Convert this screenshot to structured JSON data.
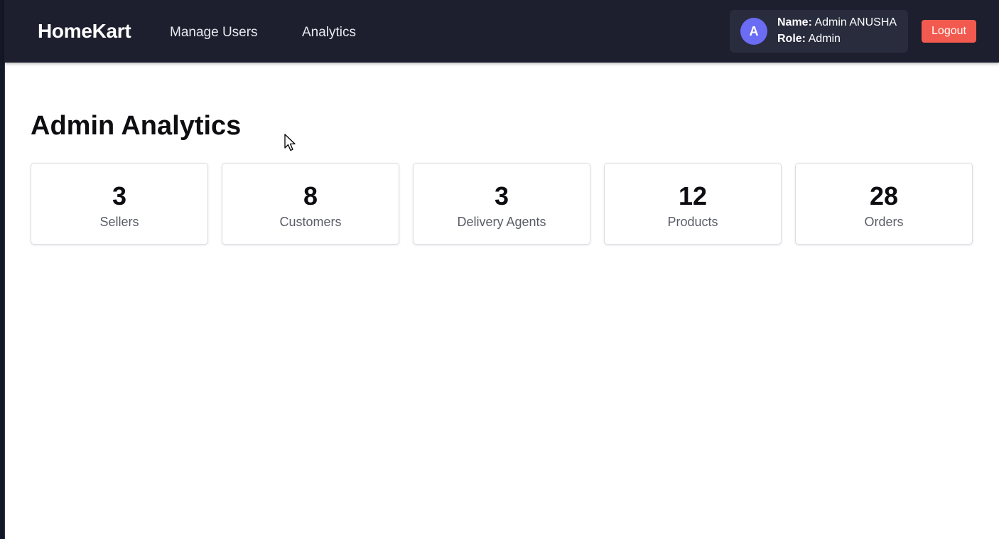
{
  "header": {
    "brand": "HomeKart",
    "nav": [
      "Manage Users",
      "Analytics"
    ],
    "user": {
      "avatar_initial": "A",
      "name_label": "Name:",
      "name_value": "Admin ANUSHA",
      "role_label": "Role:",
      "role_value": "Admin"
    },
    "logout_label": "Logout"
  },
  "main": {
    "title": "Admin Analytics",
    "stats": [
      {
        "value": "3",
        "label": "Sellers"
      },
      {
        "value": "8",
        "label": "Customers"
      },
      {
        "value": "3",
        "label": "Delivery Agents"
      },
      {
        "value": "12",
        "label": "Products"
      },
      {
        "value": "28",
        "label": "Orders"
      }
    ]
  },
  "colors": {
    "navbar_bg": "#1d1f2e",
    "avatar_bg": "#6b6cf4",
    "logout_bg": "#f35a4f"
  },
  "icons": {
    "cursor": "mouse-pointer-icon"
  }
}
